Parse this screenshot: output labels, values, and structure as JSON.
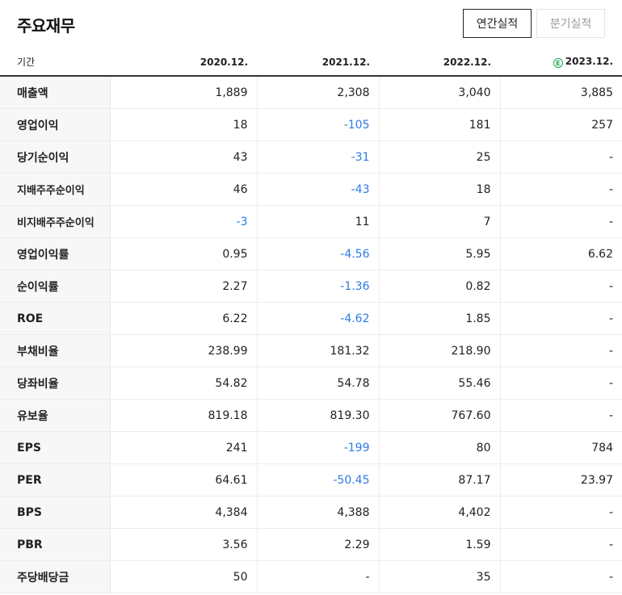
{
  "header": {
    "title": "주요재무",
    "tabs": [
      {
        "label": "연간실적",
        "active": true
      },
      {
        "label": "분기실적",
        "active": false
      }
    ]
  },
  "table": {
    "columns": [
      "기간",
      "2020.12.",
      "2021.12.",
      "2022.12.",
      "2023.12."
    ],
    "estimate_mark": "E",
    "rows": [
      {
        "label": "매출액",
        "values": [
          "1,889",
          "2,308",
          "3,040",
          "3,885"
        ]
      },
      {
        "label": "영업이익",
        "values": [
          "18",
          "-105",
          "181",
          "257"
        ]
      },
      {
        "label": "당기순이익",
        "values": [
          "43",
          "-31",
          "25",
          "-"
        ]
      },
      {
        "label": "지배주주순이익",
        "values": [
          "46",
          "-43",
          "18",
          "-"
        ]
      },
      {
        "label": "비지배주주순이익",
        "values": [
          "-3",
          "11",
          "7",
          "-"
        ]
      },
      {
        "label": "영업이익률",
        "values": [
          "0.95",
          "-4.56",
          "5.95",
          "6.62"
        ]
      },
      {
        "label": "순이익률",
        "values": [
          "2.27",
          "-1.36",
          "0.82",
          "-"
        ]
      },
      {
        "label": "ROE",
        "values": [
          "6.22",
          "-4.62",
          "1.85",
          "-"
        ]
      },
      {
        "label": "부채비율",
        "values": [
          "238.99",
          "181.32",
          "218.90",
          "-"
        ]
      },
      {
        "label": "당좌비율",
        "values": [
          "54.82",
          "54.78",
          "55.46",
          "-"
        ]
      },
      {
        "label": "유보율",
        "values": [
          "819.18",
          "819.30",
          "767.60",
          "-"
        ]
      },
      {
        "label": "EPS",
        "values": [
          "241",
          "-199",
          "80",
          "784"
        ]
      },
      {
        "label": "PER",
        "values": [
          "64.61",
          "-50.45",
          "87.17",
          "23.97"
        ]
      },
      {
        "label": "BPS",
        "values": [
          "4,384",
          "4,388",
          "4,402",
          "-"
        ]
      },
      {
        "label": "PBR",
        "values": [
          "3.56",
          "2.29",
          "1.59",
          "-"
        ]
      },
      {
        "label": "주당배당금",
        "values": [
          "50",
          "-",
          "35",
          "-"
        ]
      }
    ]
  },
  "colors": {
    "negative": "#2c7be5",
    "estimate": "#1aa34a"
  }
}
